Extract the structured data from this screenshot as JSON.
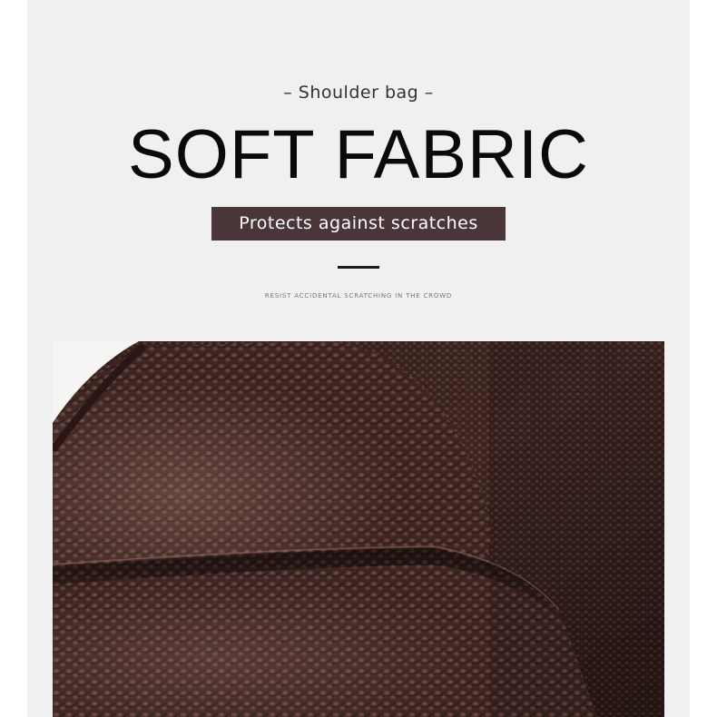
{
  "header": {
    "subtitle": "– Shoulder bag –",
    "title": "SOFT FABRIC",
    "tag": "Protects against scratches",
    "fine_print": "RESIST ACCIDENTAL SCRATCHING IN THE CROWD"
  },
  "colors": {
    "background": "#f0f0f0",
    "tag_background": "#4a3638",
    "leather": "#3a2220"
  }
}
